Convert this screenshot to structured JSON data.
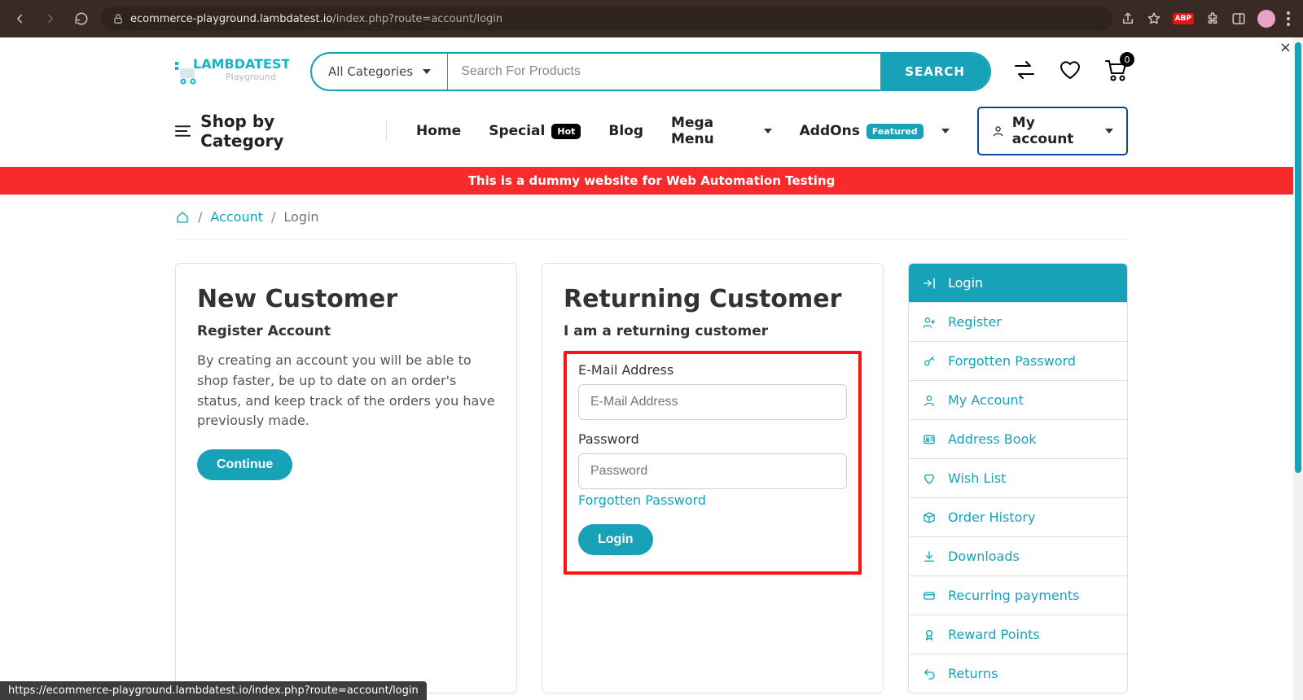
{
  "browser": {
    "url_host": "ecommerce-playground.lambdatest.io",
    "url_path": "/index.php?route=account/login",
    "adp": "ABP",
    "status_url": "https://ecommerce-playground.lambdatest.io/index.php?route=account/login"
  },
  "logo": {
    "top": "LAMBDATEST",
    "sub": "Playground"
  },
  "search": {
    "category": "All Categories",
    "placeholder": "Search For Products",
    "button": "SEARCH"
  },
  "cart_count": "0",
  "nav": {
    "shop_by_category": "Shop by Category",
    "home": "Home",
    "special": "Special",
    "special_badge": "Hot",
    "blog": "Blog",
    "mega": "Mega Menu",
    "addons": "AddOns",
    "addons_badge": "Featured",
    "my_account": "My account"
  },
  "banner": "This is a dummy website for Web Automation Testing",
  "breadcrumb": {
    "account": "Account",
    "login": "Login"
  },
  "new_customer": {
    "title": "New Customer",
    "subtitle": "Register Account",
    "desc": "By creating an account you will be able to shop faster, be up to date on an order's status, and keep track of the orders you have previously made.",
    "button": "Continue"
  },
  "returning": {
    "title": "Returning Customer",
    "subtitle": "I am a returning customer",
    "email_label": "E-Mail Address",
    "email_placeholder": "E-Mail Address",
    "password_label": "Password",
    "password_placeholder": "Password",
    "forgot": "Forgotten Password",
    "button": "Login"
  },
  "sidebar": {
    "items": [
      {
        "label": "Login",
        "icon": "sign-in",
        "active": true
      },
      {
        "label": "Register",
        "icon": "user-plus"
      },
      {
        "label": "Forgotten Password",
        "icon": "key"
      },
      {
        "label": "My Account",
        "icon": "user"
      },
      {
        "label": "Address Book",
        "icon": "address-card"
      },
      {
        "label": "Wish List",
        "icon": "heart"
      },
      {
        "label": "Order History",
        "icon": "box"
      },
      {
        "label": "Downloads",
        "icon": "download"
      },
      {
        "label": "Recurring payments",
        "icon": "credit-card"
      },
      {
        "label": "Reward Points",
        "icon": "medal"
      },
      {
        "label": "Returns",
        "icon": "undo"
      }
    ]
  }
}
